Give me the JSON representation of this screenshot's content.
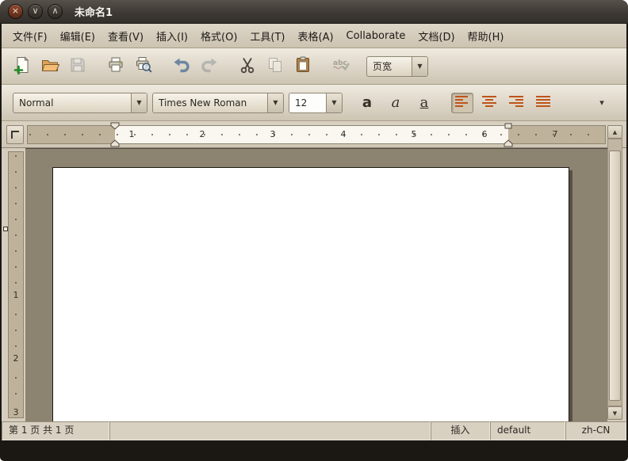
{
  "window": {
    "title": "未命名1"
  },
  "window_controls": {
    "close": "×",
    "minimize": "∨",
    "maximize": "∧"
  },
  "menubar": {
    "items": [
      "文件(F)",
      "编辑(E)",
      "查看(V)",
      "插入(I)",
      "格式(O)",
      "工具(T)",
      "表格(A)",
      "Collaborate",
      "文档(D)",
      "帮助(H)"
    ]
  },
  "toolbar_top": {
    "zoom_value": "页宽"
  },
  "toolbar_format": {
    "style_value": "Normal",
    "font_value": "Times New Roman",
    "size_value": "12",
    "bold_label": "a",
    "italic_label": "a",
    "underline_label": "a"
  },
  "ruler": {
    "horizontal_numbers": [
      "1",
      "2",
      "3",
      "4",
      "5",
      "6",
      "7"
    ],
    "vertical_numbers": [
      "1",
      "2",
      "3"
    ]
  },
  "statusbar": {
    "page_indicator": "第 1 页 共 1 页",
    "insert_mode": "插入",
    "style_name": "default",
    "language": "zh-CN"
  },
  "icons": {
    "combo_arrow": "▼",
    "overflow_arrow": "▾",
    "scroll_up": "▲",
    "scroll_down": "▼"
  },
  "colors": {
    "accent_orange": "#c0541b",
    "toolbar_beige": "#d6cdbe",
    "document_background": "#8d8371",
    "titlebar_brown": "#3d3833"
  }
}
